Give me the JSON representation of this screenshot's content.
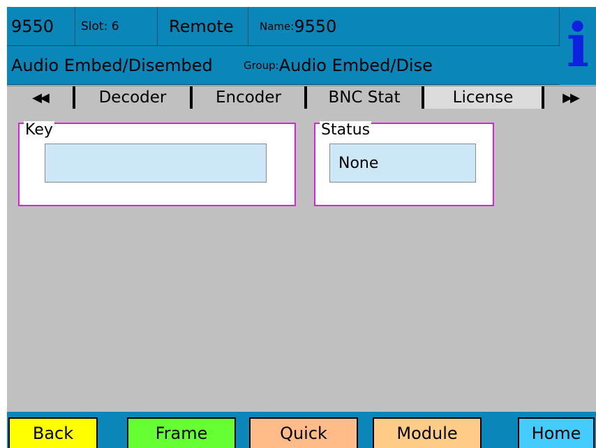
{
  "header": {
    "unit": "9550",
    "slot": "Slot: 6",
    "mode": "Remote",
    "name_label": "Name:",
    "name_value": "9550",
    "module": "Audio Embed/Disembed",
    "group_label": "Group:",
    "group_value": "Audio Embed/Dise",
    "info_glyph": "i"
  },
  "tabs": {
    "prev": "◀◀",
    "items": [
      "Decoder",
      "Encoder",
      "BNC Stat",
      "License"
    ],
    "active": "License",
    "next": "▶▶"
  },
  "panels": {
    "key": {
      "label": "Key",
      "value": ""
    },
    "status": {
      "label": "Status",
      "value": "None"
    }
  },
  "nav": {
    "back": "Back",
    "frame": "Frame",
    "quick": "Quick",
    "module": "Module",
    "home": "Home"
  },
  "colors": {
    "header_bg": "#0a86b8",
    "body_bg": "#c0c0c0",
    "group_border": "#e020e0",
    "field_bg": "#cce8f7",
    "info_icon": "#1020e0",
    "back_btn": "#ffff00",
    "frame_btn": "#66ff33",
    "quick_btn": "#ffbb88",
    "module_btn": "#ffcc88",
    "home_btn": "#44ccff"
  }
}
